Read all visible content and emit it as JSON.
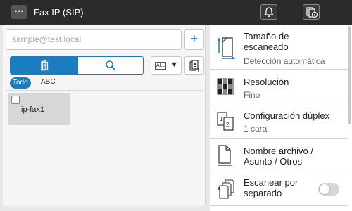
{
  "header": {
    "menu_label": "⋯",
    "title": "Fax IP (SIP)",
    "icons": [
      "bell-icon",
      "job-status-icon"
    ]
  },
  "left": {
    "destination_placeholder": "sample@test.local",
    "add_label": "+",
    "tabs": [
      "address-book-icon",
      "search-icon"
    ],
    "filter_tag": "ALL",
    "filter_caret": "▼",
    "index": {
      "active": "Todo",
      "other": "ABC"
    },
    "destinations": [
      {
        "name": "ip-fax1",
        "checked": false
      }
    ]
  },
  "settings": [
    {
      "title": "Tamaño de escaneado",
      "value": "Detección automática",
      "icon": "scan-size-icon"
    },
    {
      "title": "Resolución",
      "value": "Fino",
      "icon": "resolution-icon"
    },
    {
      "title": "Configuración dúplex",
      "value": "1 cara",
      "icon": "duplex-icon"
    },
    {
      "title": "Nombre archivo / Asunto / Otros",
      "value": "",
      "icon": "file-name-icon"
    },
    {
      "title": "Escanear por separado",
      "value": "",
      "icon": "separate-scan-icon",
      "toggle": false
    }
  ],
  "colors": {
    "accent": "#1b7dc0",
    "header_bg": "#2b2b2b",
    "card_bg": "#d7d7d7"
  }
}
